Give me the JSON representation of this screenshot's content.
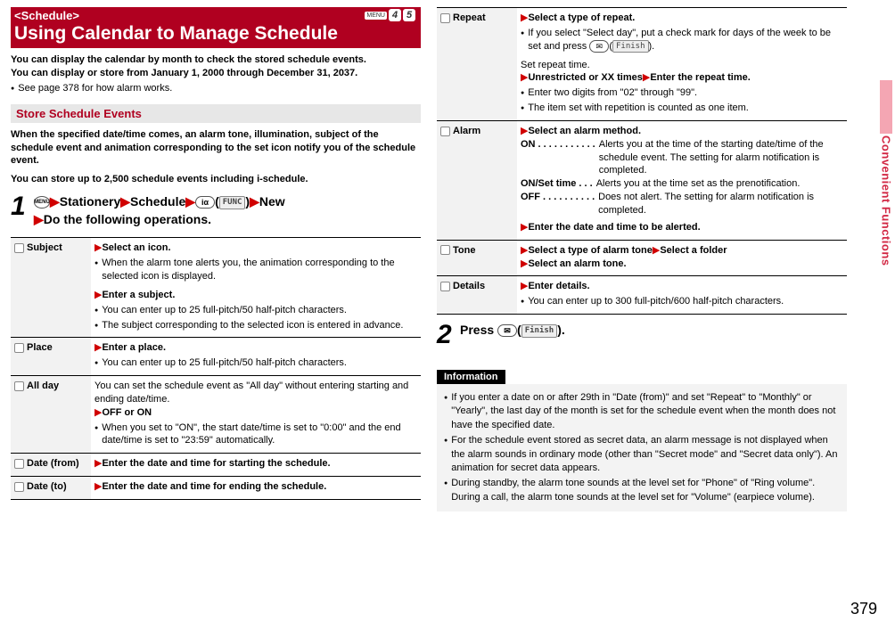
{
  "header": {
    "tag": "<Schedule>",
    "title": "Using Calendar to Manage Schedule",
    "menu_badge": "MENU",
    "num_a": "4",
    "num_b": "5"
  },
  "intro": {
    "line1": "You can display the calendar by month to check the stored schedule events.",
    "line2": "You can display or store from January 1, 2000 through December 31, 2037.",
    "bullet1": "See page 378 for how alarm works."
  },
  "section1": {
    "title": "Store Schedule Events",
    "intro1": "When the specified date/time comes, an alarm tone, illumination, subject of the schedule event and animation corresponding to the set icon notify you of the schedule event.",
    "intro2": "You can store up to 2,500 schedule events including i-schedule."
  },
  "step1": {
    "num": "1",
    "stationery": "Stationery",
    "schedule": "Schedule",
    "func": "FUNC",
    "new": "New",
    "do_ops": "Do the following operations."
  },
  "ops": {
    "subject": {
      "label": "Subject",
      "l1": "Select an icon.",
      "b1": "When the alarm tone alerts you, the animation corresponding to the selected icon is displayed.",
      "l2": "Enter a subject.",
      "b2": "You can enter up to 25 full-pitch/50 half-pitch characters.",
      "b3": "The subject corresponding to the selected icon is entered in advance."
    },
    "place": {
      "label": "Place",
      "l1": "Enter a place.",
      "b1": "You can enter up to 25 full-pitch/50 half-pitch characters."
    },
    "allday": {
      "label": "All day",
      "t1": "You can set the schedule event as \"All day\" without entering starting and ending date/time.",
      "l1": "OFF or ON",
      "b1": "When you set to \"ON\", the start date/time is set to \"0:00\" and the end date/time is set to \"23:59\" automatically."
    },
    "datefrom": {
      "label": "Date (from)",
      "l1": "Enter the date and time for starting the schedule."
    },
    "dateto": {
      "label": "Date (to)",
      "l1": "Enter the date and time for ending the schedule."
    },
    "repeat": {
      "label": "Repeat",
      "l1": "Select a type of repeat.",
      "b1": "If you select \"Select day\", put a check mark for days of the week to be set and press ",
      "b1b": "(",
      "b1c": ").",
      "t2": "Set repeat time.",
      "l2": "Unrestricted or XX times",
      "l2b": "Enter the repeat time.",
      "b3": "Enter two digits from \"02\" through \"99\".",
      "b4": "The item set with repetition is counted as one item.",
      "finish": "Finish"
    },
    "alarm": {
      "label": "Alarm",
      "l1": "Select an alarm method.",
      "on_k": "ON",
      "on_v": "Alerts you at the time of the starting date/time of the schedule event. The setting for alarm notification is completed.",
      "set_k": "ON/Set time",
      "set_v": "Alerts you at the time set as the prenotification.",
      "off_k": "OFF",
      "off_v": "Does not alert. The setting for alarm notification is completed.",
      "l2": "Enter the date and time to be alerted."
    },
    "tone": {
      "label": "Tone",
      "l1": "Select a type of alarm tone",
      "l1b": "Select a folder",
      "l2": "Select an alarm tone."
    },
    "details": {
      "label": "Details",
      "l1": "Enter details.",
      "b1": "You can enter up to 300 full-pitch/600 half-pitch characters."
    }
  },
  "step2": {
    "num": "2",
    "press": "Press ",
    "finish": "Finish",
    "paren_close": ")."
  },
  "info": {
    "title": "Information",
    "b1": "If you enter a date on or after 29th in \"Date (from)\" and set \"Repeat\" to \"Monthly\" or \"Yearly\", the last day of the month is set for the schedule event when the month does not have the specified date.",
    "b2": "For the schedule event stored as secret data, an alarm message is not displayed when the alarm sounds in ordinary mode (other than \"Secret mode\" and \"Secret data only\"). An animation for secret data appears.",
    "b3": "During standby, the alarm tone sounds at the level set for \"Phone\" of \"Ring volume\". During a call, the alarm tone sounds at the level set for \"Volume\" (earpiece volume)."
  },
  "side": {
    "label": "Convenient Functions"
  },
  "page": "379"
}
